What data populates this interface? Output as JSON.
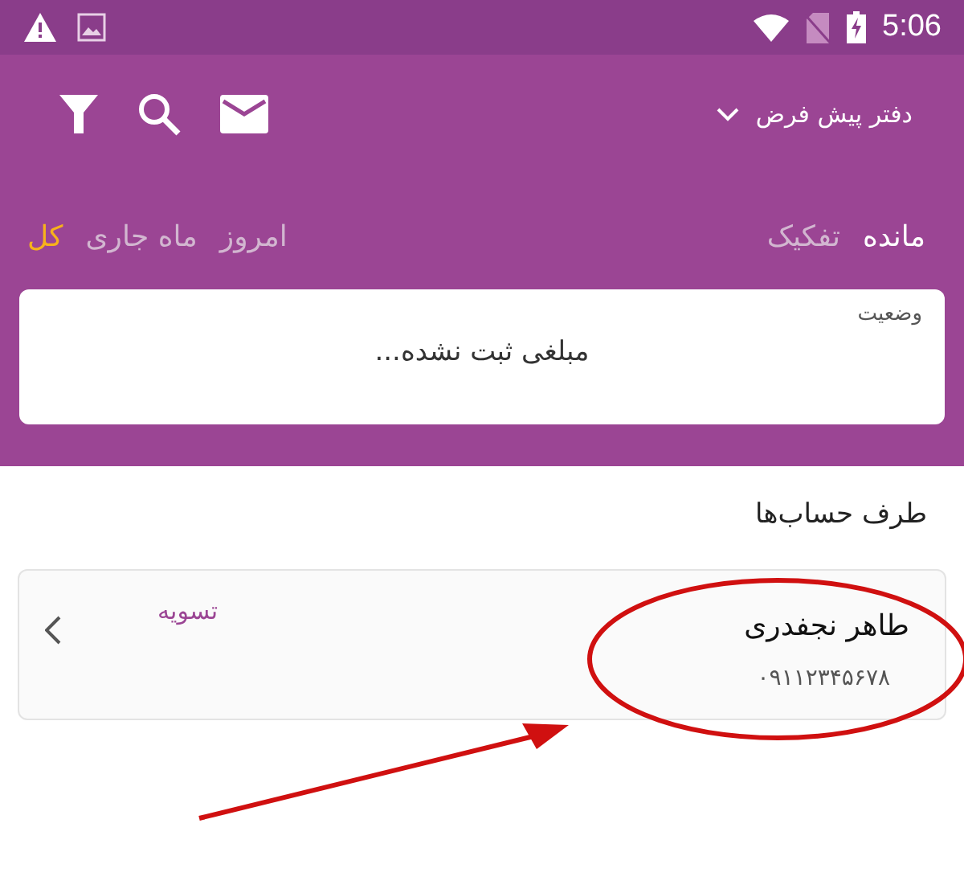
{
  "status_bar": {
    "time": "5:06"
  },
  "toolbar": {
    "title": "دفتر پیش فرض"
  },
  "tab_groups": [
    [
      {
        "label": "مانده",
        "selected": true
      },
      {
        "label": "تفکیک",
        "selected": false
      }
    ],
    [
      {
        "label": "امروز",
        "selected": false
      },
      {
        "label": "ماه جاری",
        "selected": false
      },
      {
        "label": "کل",
        "selected": true
      }
    ]
  ],
  "status_card": {
    "label": "وضعیت",
    "value": "مبلغی ثبت نشده..."
  },
  "section_title": "طرف حساب‌ها",
  "accounts": [
    {
      "name": "طاهر نجفدری",
      "phone": "۰۹۱۱۲۳۴۵۶۷۸",
      "action": "تسویه"
    }
  ]
}
